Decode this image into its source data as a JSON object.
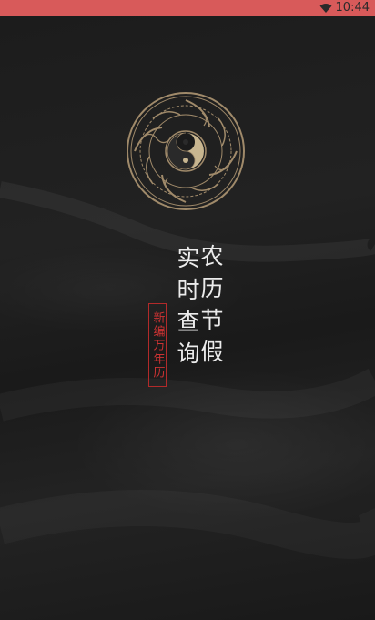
{
  "status_bar": {
    "time": "10:44",
    "bg_color": "#d85a5a",
    "icons": [
      "wifi-icon"
    ]
  },
  "splash": {
    "bg_color": "#1b1b1b",
    "emblem": {
      "icon": "taiji-emblem-icon",
      "color": "#a08a6a"
    },
    "headline_col_1": "农历节假",
    "headline_col_2": "实时查询",
    "seal_text": "新编万年历",
    "seal_color": "#b22a2a"
  }
}
